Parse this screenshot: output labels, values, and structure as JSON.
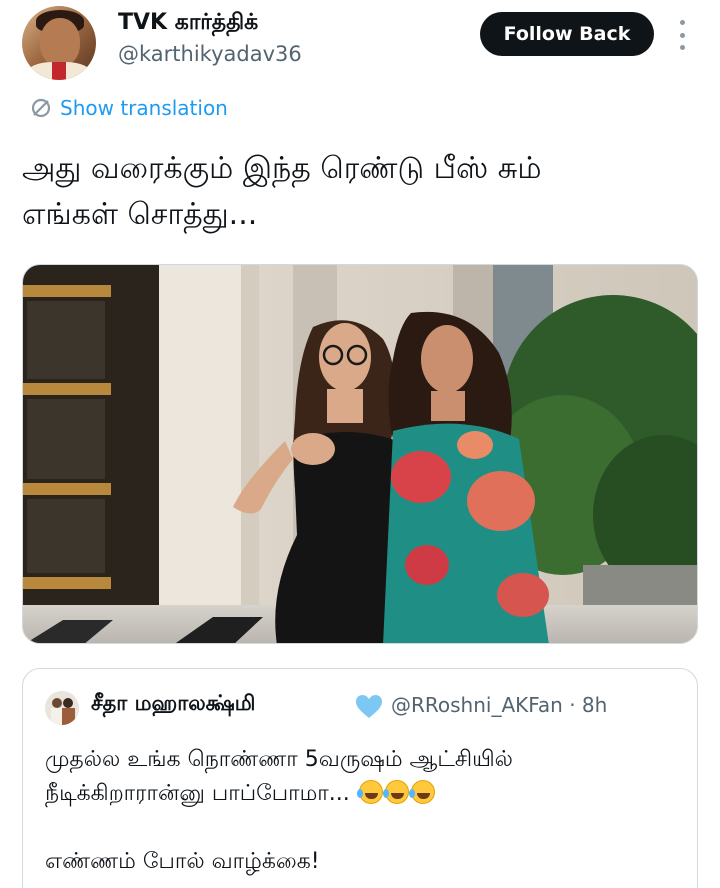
{
  "author": {
    "display_name": "TVK கார்த்திக்",
    "handle": "@karthikyadav36",
    "follow_label": "Follow Back"
  },
  "translation": {
    "label": "Show translation"
  },
  "tweet": {
    "line1": "அது வரைக்கும் இந்த ரெண்டு பீஸ் சும்",
    "line2": "எங்கள் சொத்து..."
  },
  "quote": {
    "display_name": "சீதா மஹாலக்ஷ்மி",
    "handle_time": "@RRoshni_AKFan · 8h",
    "line1": "முதல்ல உங்க நொண்ணா 5வருஷம் ஆட்சியில்",
    "line2": "நீடிக்கிறாரான்னு பாப்போமா...",
    "line3": "எண்ணம் போல் வாழ்க்கை!",
    "emoji_count": 3
  },
  "colors": {
    "accent": "#1d9bf0",
    "text": "#0f1419",
    "muted": "#536471",
    "button": "#0f1419",
    "verified": "#7cc8f2"
  }
}
